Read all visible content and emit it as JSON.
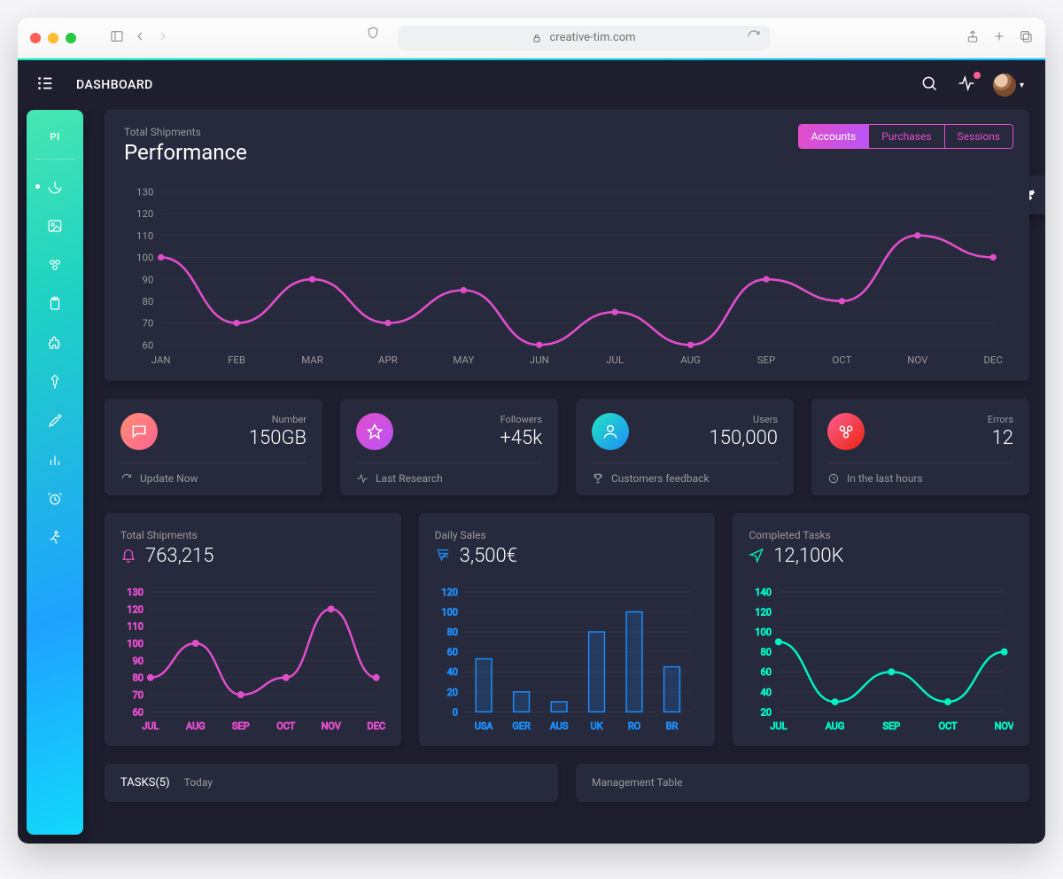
{
  "browser": {
    "url_host": "creative-tim.com"
  },
  "header": {
    "title": "DASHBOARD"
  },
  "sidebar": {
    "top_label": "PI"
  },
  "performance": {
    "subtitle": "Total Shipments",
    "title": "Performance",
    "tabs": [
      "Accounts",
      "Purchases",
      "Sessions"
    ],
    "active_tab": 0
  },
  "stats": [
    {
      "label": "Number",
      "value": "150GB",
      "footer": "Update Now",
      "color": "g-orange",
      "icon": "chat",
      "foot_icon": "refresh"
    },
    {
      "label": "Followers",
      "value": "+45k",
      "footer": "Last Research",
      "color": "g-purple",
      "icon": "star",
      "foot_icon": "pulse"
    },
    {
      "label": "Users",
      "value": "150,000",
      "footer": "Customers feedback",
      "color": "g-teal",
      "icon": "user",
      "foot_icon": "trophy"
    },
    {
      "label": "Errors",
      "value": "12",
      "footer": "In the last hours",
      "color": "g-red",
      "icon": "cluster",
      "foot_icon": "clock"
    }
  ],
  "small_charts": [
    {
      "subtitle": "Total Shipments",
      "value": "763,215",
      "tone": "mc-pink",
      "icon": "bell"
    },
    {
      "subtitle": "Daily Sales",
      "value": "3,500€",
      "tone": "mc-blue",
      "icon": "send"
    },
    {
      "subtitle": "Completed Tasks",
      "value": "12,100K",
      "tone": "mc-teal",
      "icon": "plane"
    }
  ],
  "bottom": {
    "tasks_label": "TASKS(5)",
    "tasks_sub": "Today",
    "mgmt_label": "Management Table"
  },
  "chart_data": [
    {
      "id": "performance",
      "type": "line",
      "title": "Performance",
      "categories": [
        "JAN",
        "FEB",
        "MAR",
        "APR",
        "MAY",
        "JUN",
        "JUL",
        "AUG",
        "SEP",
        "OCT",
        "NOV",
        "DEC"
      ],
      "values": [
        100,
        70,
        90,
        70,
        85,
        60,
        75,
        60,
        90,
        80,
        110,
        100
      ],
      "ylim": [
        60,
        130
      ],
      "yticks": [
        60,
        70,
        80,
        90,
        100,
        110,
        120,
        130
      ],
      "color": "#e14eca"
    },
    {
      "id": "shipments",
      "type": "line",
      "title": "Total Shipments",
      "categories": [
        "JUL",
        "AUG",
        "SEP",
        "OCT",
        "NOV",
        "DEC"
      ],
      "values": [
        80,
        100,
        70,
        80,
        120,
        80
      ],
      "ylim": [
        60,
        130
      ],
      "yticks": [
        60,
        70,
        80,
        90,
        100,
        110,
        120,
        130
      ],
      "color": "#e14eca"
    },
    {
      "id": "daily_sales",
      "type": "bar",
      "title": "Daily Sales",
      "categories": [
        "USA",
        "GER",
        "AUS",
        "UK",
        "RO",
        "BR"
      ],
      "values": [
        53,
        20,
        10,
        80,
        100,
        45
      ],
      "ylim": [
        0,
        120
      ],
      "yticks": [
        0,
        20,
        40,
        60,
        80,
        100,
        120
      ],
      "color": "#1d8cf8"
    },
    {
      "id": "completed_tasks",
      "type": "line",
      "title": "Completed Tasks",
      "categories": [
        "JUL",
        "AUG",
        "SEP",
        "OCT",
        "NOV"
      ],
      "values": [
        90,
        30,
        60,
        30,
        80
      ],
      "ylim": [
        20,
        140
      ],
      "yticks": [
        20,
        40,
        60,
        80,
        100,
        120,
        140
      ],
      "color": "#00f2c3"
    }
  ]
}
